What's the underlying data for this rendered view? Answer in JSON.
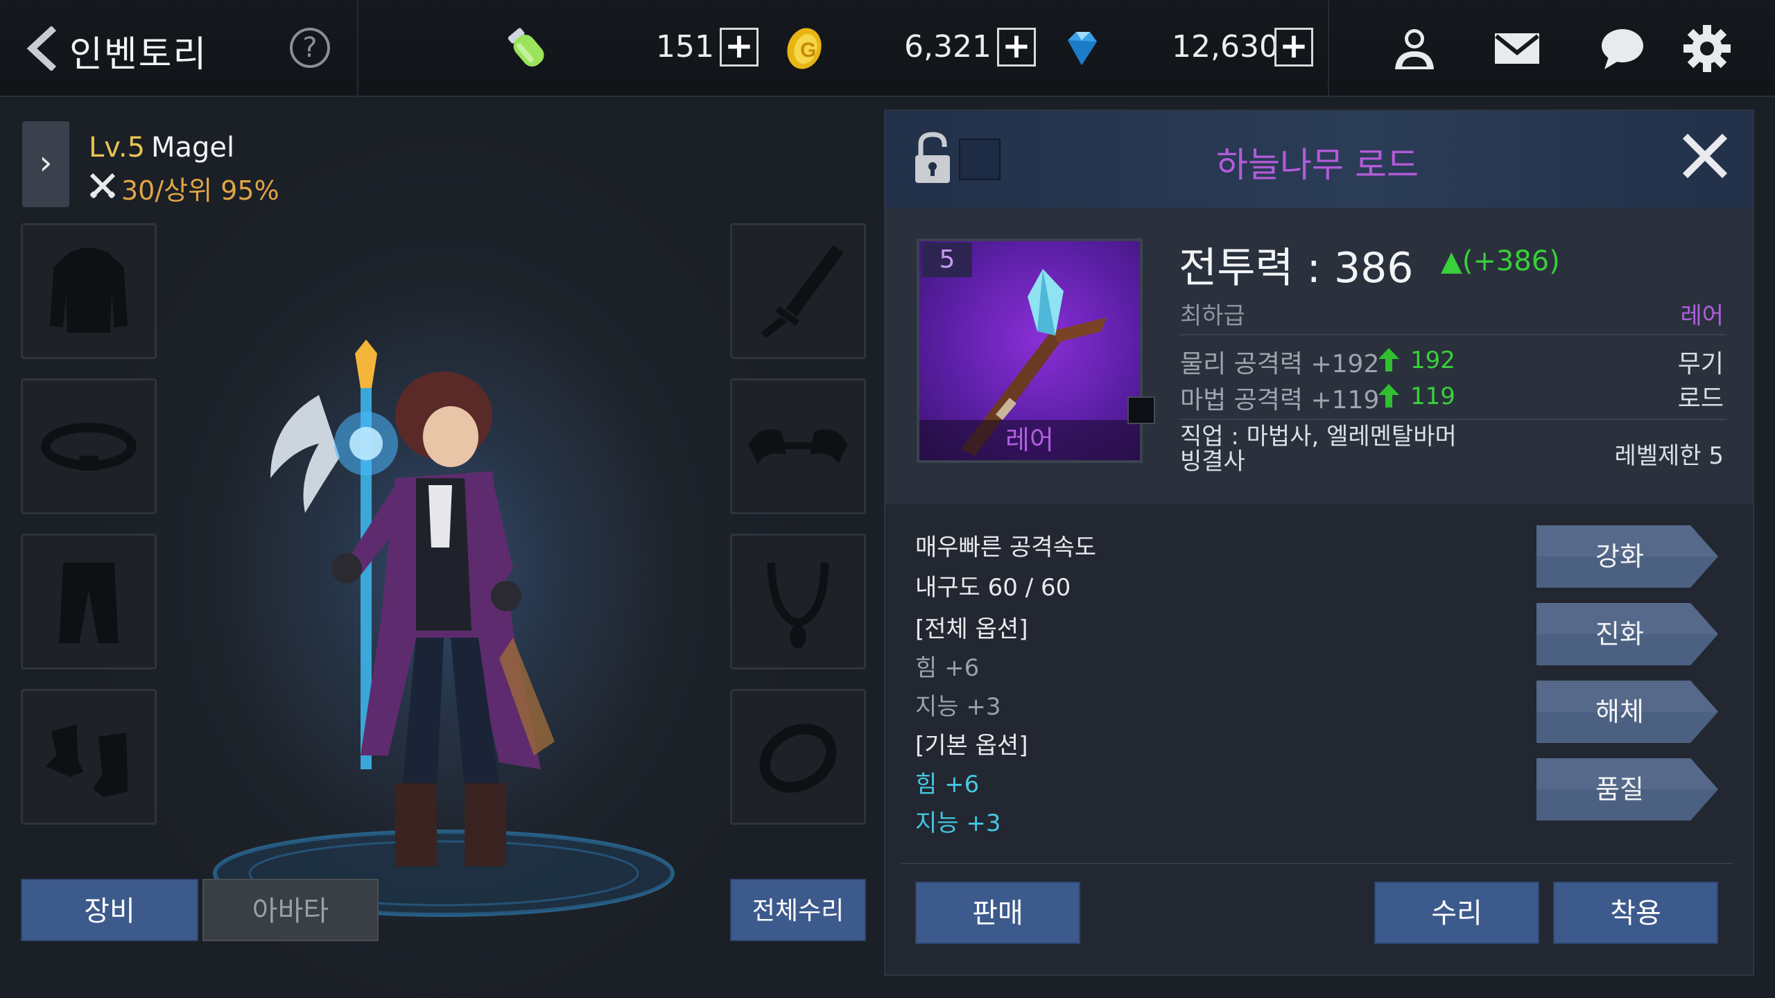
{
  "header": {
    "title": "인벤토리",
    "help": "?",
    "currencies": [
      {
        "name": "stamina",
        "icon": "stamina-potion-icon",
        "value": "151"
      },
      {
        "name": "gold",
        "icon": "gold-coin-icon",
        "value": "6,321"
      },
      {
        "name": "gem",
        "icon": "diamond-icon",
        "value": "12,630"
      }
    ],
    "plus": "+",
    "icons": [
      "friends-icon",
      "mail-icon",
      "chat-icon",
      "settings-icon"
    ]
  },
  "character": {
    "expand": "›",
    "level": "Lv.5",
    "name": "Magel",
    "power": "30/상위 95%"
  },
  "equipment_slots": {
    "left": [
      "armor-slot",
      "belt-slot",
      "pants-slot",
      "boots-slot"
    ],
    "right": [
      "weapon-slot",
      "shoulder-slot",
      "necklace-slot",
      "ring-slot"
    ]
  },
  "tabs": {
    "equip": "장비",
    "avatar": "아바타",
    "repair_all": "전체수리"
  },
  "item": {
    "name": "하늘나무 로드",
    "level": "5",
    "rarity": "레어",
    "grade": "최하급",
    "combat_power": "전투력 : 386",
    "combat_power_delta": "▲(+386)",
    "stats": [
      {
        "label": "물리 공격력 +192",
        "delta": "192"
      },
      {
        "label": "마법 공격력 +119",
        "delta": "119"
      }
    ],
    "type_lines": [
      "무기",
      "로드"
    ],
    "job": "직업 : 마법사, 엘레멘탈바머 빙결사",
    "level_limit": "레벨제한 5",
    "options": [
      {
        "text": "매우빠른 공격속도",
        "style": "white"
      },
      {
        "text": "내구도 60 / 60",
        "style": "white"
      },
      {
        "text": "[전체 옵션]",
        "style": "white"
      },
      {
        "text": "힘 +6",
        "style": "gray"
      },
      {
        "text": "지능 +3",
        "style": "gray"
      },
      {
        "text": "[기본 옵션]",
        "style": "white"
      },
      {
        "text": "힘 +6",
        "style": "cyan"
      },
      {
        "text": "지능 +3",
        "style": "cyan"
      }
    ]
  },
  "actions": [
    "강화",
    "진화",
    "해체",
    "품질"
  ],
  "bottom_buttons": {
    "sell": "판매",
    "repair": "수리",
    "equip": "착용"
  },
  "colors": {
    "accent_blue": "#3d5a8c",
    "rare_purple": "#b05ee0",
    "positive_green": "#3ad03a",
    "option_cyan": "#46c6e0",
    "level_gold": "#e6c552"
  }
}
